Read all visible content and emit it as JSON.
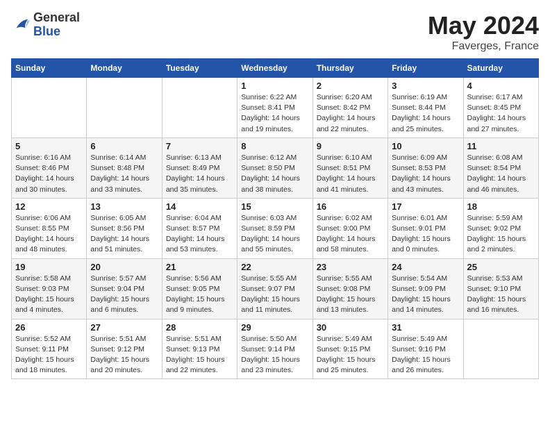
{
  "logo": {
    "general": "General",
    "blue": "Blue"
  },
  "title": "May 2024",
  "subtitle": "Faverges, France",
  "days_of_week": [
    "Sunday",
    "Monday",
    "Tuesday",
    "Wednesday",
    "Thursday",
    "Friday",
    "Saturday"
  ],
  "weeks": [
    [
      {
        "day": "",
        "info": ""
      },
      {
        "day": "",
        "info": ""
      },
      {
        "day": "",
        "info": ""
      },
      {
        "day": "1",
        "info": "Sunrise: 6:22 AM\nSunset: 8:41 PM\nDaylight: 14 hours\nand 19 minutes."
      },
      {
        "day": "2",
        "info": "Sunrise: 6:20 AM\nSunset: 8:42 PM\nDaylight: 14 hours\nand 22 minutes."
      },
      {
        "day": "3",
        "info": "Sunrise: 6:19 AM\nSunset: 8:44 PM\nDaylight: 14 hours\nand 25 minutes."
      },
      {
        "day": "4",
        "info": "Sunrise: 6:17 AM\nSunset: 8:45 PM\nDaylight: 14 hours\nand 27 minutes."
      }
    ],
    [
      {
        "day": "5",
        "info": "Sunrise: 6:16 AM\nSunset: 8:46 PM\nDaylight: 14 hours\nand 30 minutes."
      },
      {
        "day": "6",
        "info": "Sunrise: 6:14 AM\nSunset: 8:48 PM\nDaylight: 14 hours\nand 33 minutes."
      },
      {
        "day": "7",
        "info": "Sunrise: 6:13 AM\nSunset: 8:49 PM\nDaylight: 14 hours\nand 35 minutes."
      },
      {
        "day": "8",
        "info": "Sunrise: 6:12 AM\nSunset: 8:50 PM\nDaylight: 14 hours\nand 38 minutes."
      },
      {
        "day": "9",
        "info": "Sunrise: 6:10 AM\nSunset: 8:51 PM\nDaylight: 14 hours\nand 41 minutes."
      },
      {
        "day": "10",
        "info": "Sunrise: 6:09 AM\nSunset: 8:53 PM\nDaylight: 14 hours\nand 43 minutes."
      },
      {
        "day": "11",
        "info": "Sunrise: 6:08 AM\nSunset: 8:54 PM\nDaylight: 14 hours\nand 46 minutes."
      }
    ],
    [
      {
        "day": "12",
        "info": "Sunrise: 6:06 AM\nSunset: 8:55 PM\nDaylight: 14 hours\nand 48 minutes."
      },
      {
        "day": "13",
        "info": "Sunrise: 6:05 AM\nSunset: 8:56 PM\nDaylight: 14 hours\nand 51 minutes."
      },
      {
        "day": "14",
        "info": "Sunrise: 6:04 AM\nSunset: 8:57 PM\nDaylight: 14 hours\nand 53 minutes."
      },
      {
        "day": "15",
        "info": "Sunrise: 6:03 AM\nSunset: 8:59 PM\nDaylight: 14 hours\nand 55 minutes."
      },
      {
        "day": "16",
        "info": "Sunrise: 6:02 AM\nSunset: 9:00 PM\nDaylight: 14 hours\nand 58 minutes."
      },
      {
        "day": "17",
        "info": "Sunrise: 6:01 AM\nSunset: 9:01 PM\nDaylight: 15 hours\nand 0 minutes."
      },
      {
        "day": "18",
        "info": "Sunrise: 5:59 AM\nSunset: 9:02 PM\nDaylight: 15 hours\nand 2 minutes."
      }
    ],
    [
      {
        "day": "19",
        "info": "Sunrise: 5:58 AM\nSunset: 9:03 PM\nDaylight: 15 hours\nand 4 minutes."
      },
      {
        "day": "20",
        "info": "Sunrise: 5:57 AM\nSunset: 9:04 PM\nDaylight: 15 hours\nand 6 minutes."
      },
      {
        "day": "21",
        "info": "Sunrise: 5:56 AM\nSunset: 9:05 PM\nDaylight: 15 hours\nand 9 minutes."
      },
      {
        "day": "22",
        "info": "Sunrise: 5:55 AM\nSunset: 9:07 PM\nDaylight: 15 hours\nand 11 minutes."
      },
      {
        "day": "23",
        "info": "Sunrise: 5:55 AM\nSunset: 9:08 PM\nDaylight: 15 hours\nand 13 minutes."
      },
      {
        "day": "24",
        "info": "Sunrise: 5:54 AM\nSunset: 9:09 PM\nDaylight: 15 hours\nand 14 minutes."
      },
      {
        "day": "25",
        "info": "Sunrise: 5:53 AM\nSunset: 9:10 PM\nDaylight: 15 hours\nand 16 minutes."
      }
    ],
    [
      {
        "day": "26",
        "info": "Sunrise: 5:52 AM\nSunset: 9:11 PM\nDaylight: 15 hours\nand 18 minutes."
      },
      {
        "day": "27",
        "info": "Sunrise: 5:51 AM\nSunset: 9:12 PM\nDaylight: 15 hours\nand 20 minutes."
      },
      {
        "day": "28",
        "info": "Sunrise: 5:51 AM\nSunset: 9:13 PM\nDaylight: 15 hours\nand 22 minutes."
      },
      {
        "day": "29",
        "info": "Sunrise: 5:50 AM\nSunset: 9:14 PM\nDaylight: 15 hours\nand 23 minutes."
      },
      {
        "day": "30",
        "info": "Sunrise: 5:49 AM\nSunset: 9:15 PM\nDaylight: 15 hours\nand 25 minutes."
      },
      {
        "day": "31",
        "info": "Sunrise: 5:49 AM\nSunset: 9:16 PM\nDaylight: 15 hours\nand 26 minutes."
      },
      {
        "day": "",
        "info": ""
      }
    ]
  ]
}
